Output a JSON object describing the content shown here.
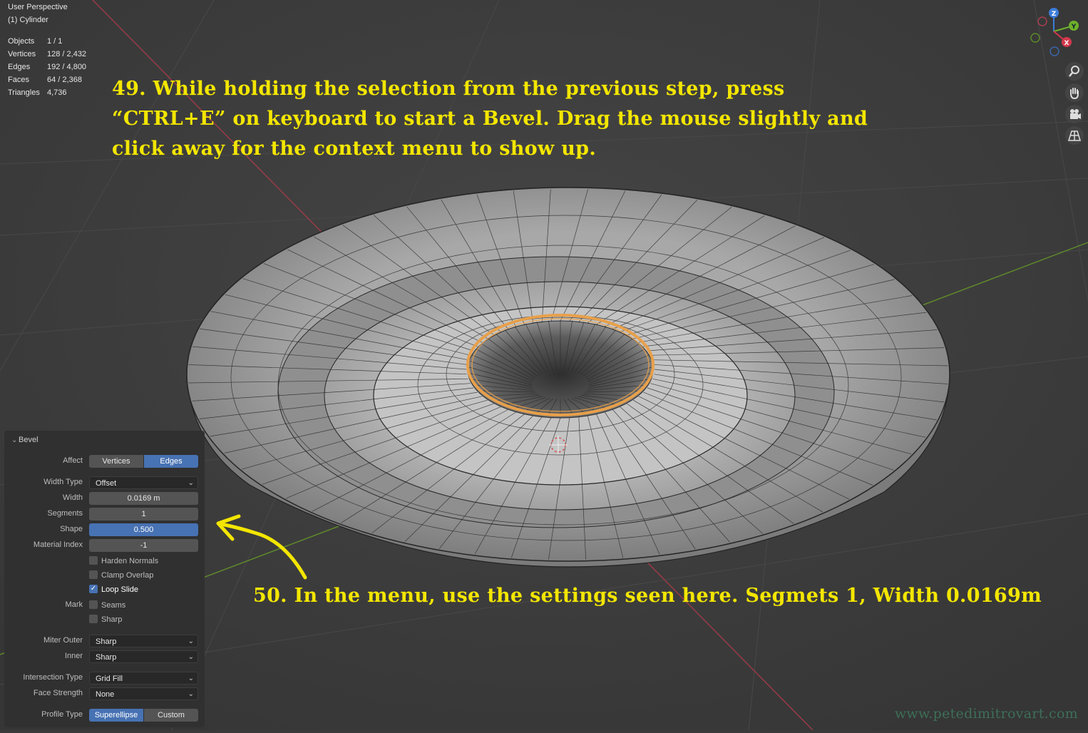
{
  "viewport": {
    "view_name": "User Perspective",
    "object_name": "(1) Cylinder",
    "stats": [
      {
        "label": "Objects",
        "value": "1 / 1"
      },
      {
        "label": "Vertices",
        "value": "128 / 2,432"
      },
      {
        "label": "Edges",
        "value": "192 / 4,800"
      },
      {
        "label": "Faces",
        "value": "64 / 2,368"
      },
      {
        "label": "Triangles",
        "value": "4,736"
      }
    ],
    "gizmo": {
      "z": "Z",
      "y": "Y",
      "x": "X"
    },
    "nav_icons": [
      "zoom-icon",
      "hand-pan-icon",
      "camera-icon",
      "grid-perspective-icon"
    ]
  },
  "annotations": {
    "step49": "49. While holding the selection from the previous step, press “CTRL+E” on keyboard to start a Bevel. Drag the mouse slightly and click away for the context menu to show up.",
    "step50": "50. In the menu, use the settings seen here. Segmets 1, Width 0.0169m",
    "watermark": "www.petedimitrovart.com"
  },
  "bevel_panel": {
    "title": "Bevel",
    "affect": {
      "label": "Affect",
      "options": [
        "Vertices",
        "Edges"
      ],
      "selected": "Edges"
    },
    "width_type": {
      "label": "Width Type",
      "value": "Offset"
    },
    "width": {
      "label": "Width",
      "value": "0.0169 m"
    },
    "segments": {
      "label": "Segments",
      "value": "1"
    },
    "shape": {
      "label": "Shape",
      "value": "0.500"
    },
    "material_index": {
      "label": "Material Index",
      "value": "-1"
    },
    "harden_normals": {
      "label": "Harden Normals",
      "checked": false
    },
    "clamp_overlap": {
      "label": "Clamp Overlap",
      "checked": false
    },
    "loop_slide": {
      "label": "Loop Slide",
      "checked": true
    },
    "mark": {
      "label": "Mark",
      "seams": "Seams",
      "sharp": "Sharp"
    },
    "miter_outer": {
      "label": "Miter Outer",
      "value": "Sharp"
    },
    "inner": {
      "label": "Inner",
      "value": "Sharp"
    },
    "intersection_type": {
      "label": "Intersection Type",
      "value": "Grid Fill"
    },
    "face_strength": {
      "label": "Face Strength",
      "value": "None"
    },
    "profile_type": {
      "label": "Profile Type",
      "options": [
        "Superellipse",
        "Custom"
      ],
      "selected": "Superellipse"
    }
  },
  "colors": {
    "selection_orange": "#e8a04a",
    "annotation_yellow": "#f3e600",
    "x_axis_red": "#c0344a",
    "y_axis_green": "#6a9a2a",
    "accent_blue": "#4772b3"
  }
}
